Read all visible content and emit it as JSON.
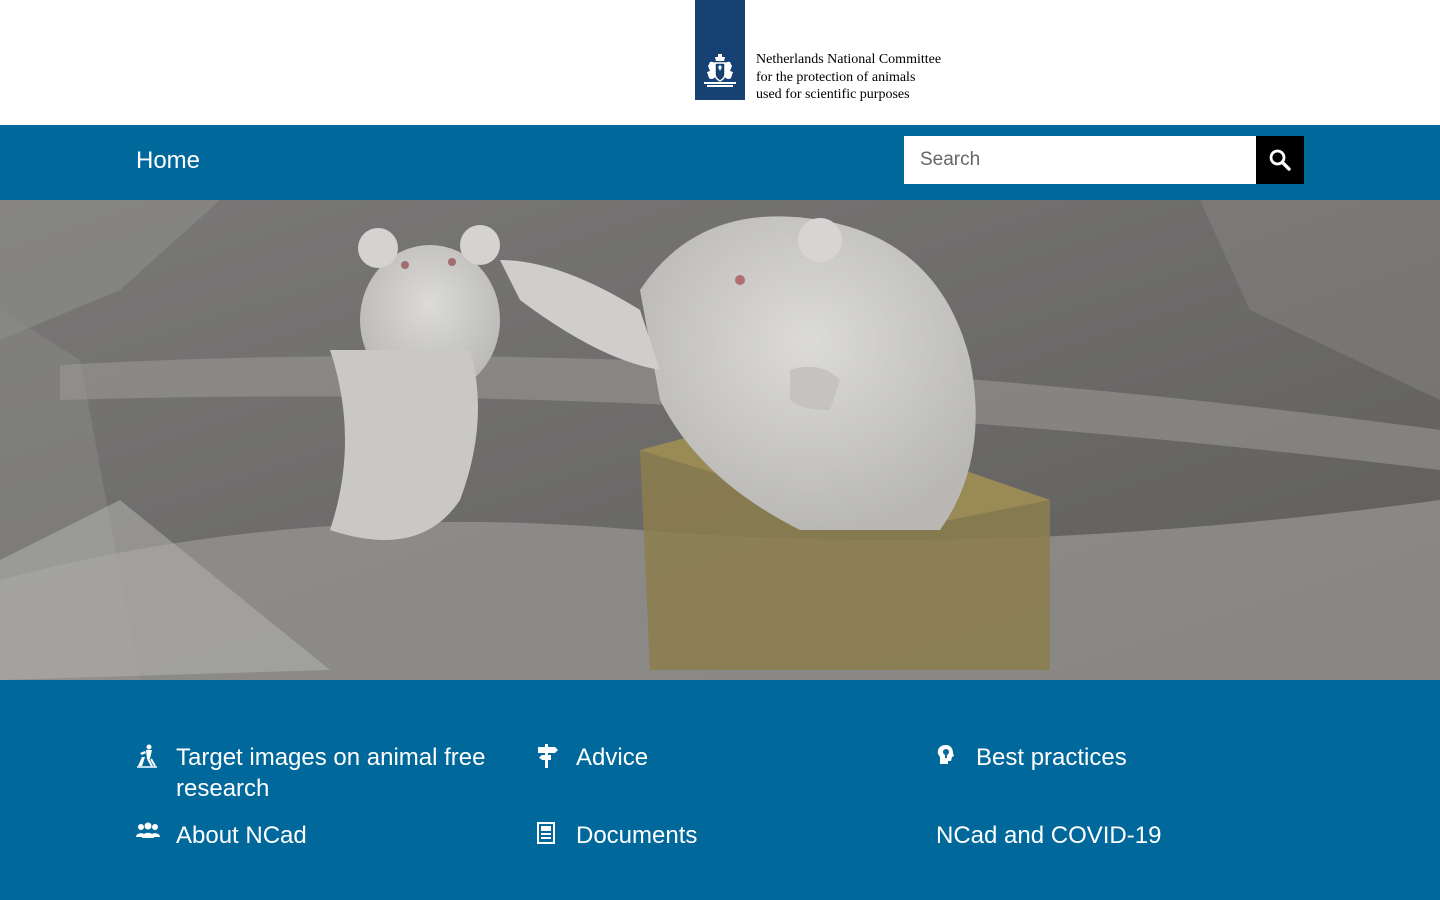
{
  "header": {
    "logo_icon": "royal-coat-of-arms",
    "logo_lines": [
      "Netherlands National Committee",
      "for the protection of animals",
      "used for scientific purposes"
    ],
    "brand_color": "#154273"
  },
  "nav": {
    "home_label": "Home",
    "background": "#01689b",
    "search": {
      "placeholder": "Search",
      "value": "",
      "button_icon": "search-icon"
    }
  },
  "hero": {
    "image_subject": "white-rats-in-cage"
  },
  "links": [
    {
      "label": "Target images on animal free research",
      "icon": "scientist-icon"
    },
    {
      "label": "Advice",
      "icon": "signpost-icon"
    },
    {
      "label": "Best practices",
      "icon": "head-lightbulb-icon"
    },
    {
      "label": "About NCad",
      "icon": "people-icon"
    },
    {
      "label": "Documents",
      "icon": "document-icon"
    },
    {
      "label": "NCad and COVID-19",
      "icon": ""
    }
  ]
}
